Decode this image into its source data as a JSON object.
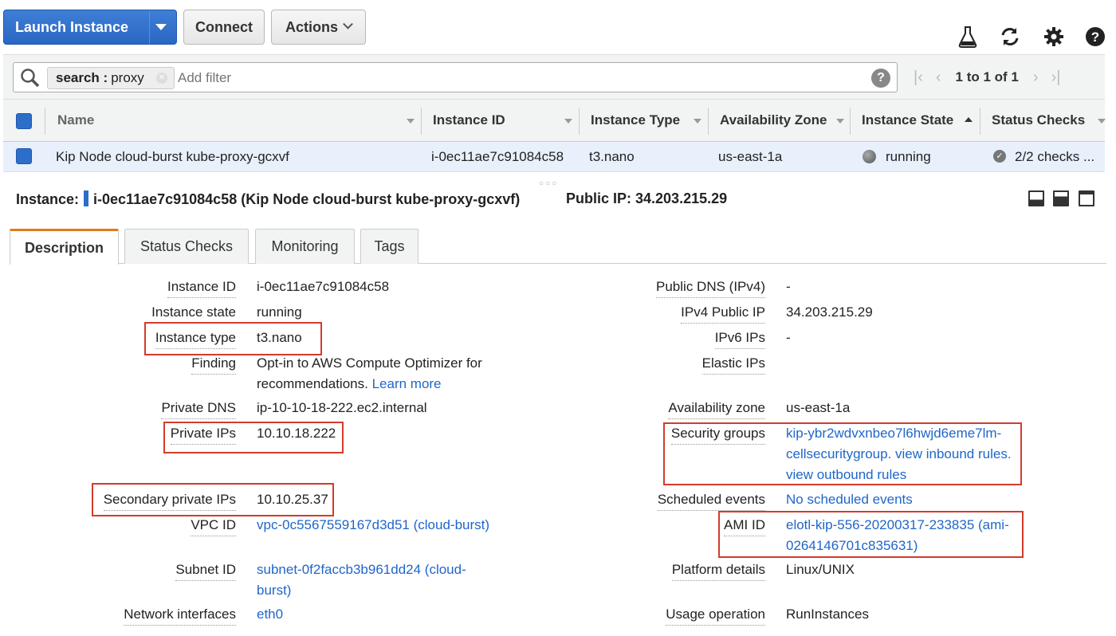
{
  "toolbar": {
    "launch_label": "Launch Instance",
    "connect_label": "Connect",
    "actions_label": "Actions"
  },
  "filter": {
    "token_key": "search :",
    "token_value": "proxy",
    "placeholder": "Add filter",
    "pagination": "1 to 1 of 1"
  },
  "table": {
    "headers": [
      "Name",
      "Instance ID",
      "Instance Type",
      "Availability Zone",
      "Instance State",
      "Status Checks"
    ],
    "rows": [
      {
        "name": "Kip Node cloud-burst kube-proxy-gcxvf",
        "instance_id": "i-0ec11ae7c91084c58",
        "instance_type": "t3.nano",
        "az": "us-east-1a",
        "state": "running",
        "status_checks": "2/2 checks ..."
      }
    ]
  },
  "instance_header": {
    "prefix": "Instance:",
    "title": "i-0ec11ae7c91084c58 (Kip Node cloud-burst kube-proxy-gcxvf)",
    "public_ip": "Public IP: 34.203.215.29"
  },
  "tabs": [
    "Description",
    "Status Checks",
    "Monitoring",
    "Tags"
  ],
  "details_left": {
    "instance_id": {
      "label": "Instance ID",
      "value": "i-0ec11ae7c91084c58"
    },
    "instance_state": {
      "label": "Instance state",
      "value": "running"
    },
    "instance_type": {
      "label": "Instance type",
      "value": "t3.nano"
    },
    "finding": {
      "label": "Finding",
      "value": "Opt-in to AWS Compute Optimizer for recommendations.",
      "link": "Learn more"
    },
    "private_dns": {
      "label": "Private DNS",
      "value": "ip-10-10-18-222.ec2.internal"
    },
    "private_ips": {
      "label": "Private IPs",
      "value": "10.10.18.222"
    },
    "secondary_ips": {
      "label": "Secondary private IPs",
      "value": "10.10.25.37"
    },
    "vpc_id": {
      "label": "VPC ID",
      "value": "vpc-0c5567559167d3d51 (cloud-burst)"
    },
    "subnet_id": {
      "label": "Subnet ID",
      "value_line1": "subnet-0f2faccb3b961dd24 (cloud-",
      "value_line2": "burst)"
    },
    "network_interfaces": {
      "label": "Network interfaces",
      "value": "eth0"
    }
  },
  "details_right": {
    "public_dns": {
      "label": "Public DNS (IPv4)",
      "value": "-"
    },
    "ipv4_public": {
      "label": "IPv4 Public IP",
      "value": "34.203.215.29"
    },
    "ipv6": {
      "label": "IPv6 IPs",
      "value": "-"
    },
    "elastic": {
      "label": "Elastic IPs",
      "value": ""
    },
    "az": {
      "label": "Availability zone",
      "value": "us-east-1a"
    },
    "security_groups": {
      "label": "Security groups",
      "line1": "kip-ybr2wdvxnbeo7l6hwjd6eme7lm-",
      "line2": "cellsecuritygroup.",
      "inbound": "view inbound rules.",
      "outbound": "view outbound rules"
    },
    "scheduled": {
      "label": "Scheduled events",
      "value": "No scheduled events"
    },
    "ami": {
      "label": "AMI ID",
      "line1": "elotl-kip-556-20200317-233835 (ami-",
      "line2": "0264146701c835631)"
    },
    "platform": {
      "label": "Platform details",
      "value": "Linux/UNIX"
    },
    "usage": {
      "label": "Usage operation",
      "value": "RunInstances"
    }
  },
  "colors": {
    "primary_blue": "#2d6ec8",
    "link": "#1f66c9",
    "highlight": "#d33b2c",
    "active_tab": "#e07b1a"
  }
}
